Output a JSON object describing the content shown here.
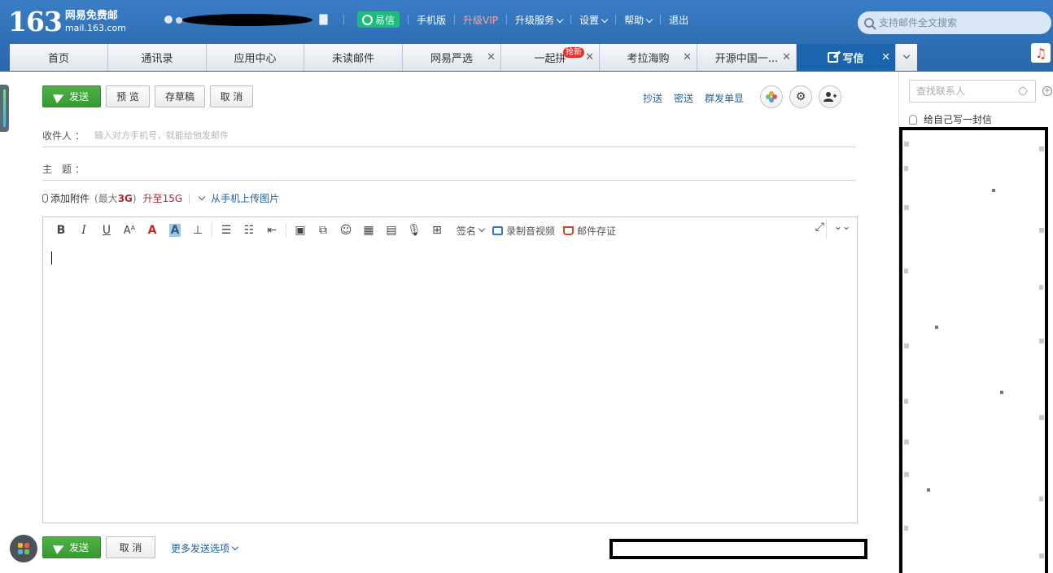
{
  "header": {
    "logo_number": "163",
    "logo_name": "网易免费邮",
    "logo_domain": "mail.163.com",
    "nav": {
      "yixin": "易信",
      "mobile": "手机版",
      "vip": "升级VIP",
      "upgrade_service": "升级服务",
      "settings": "设置",
      "help": "帮助",
      "logout": "退出"
    },
    "search_placeholder": "支持邮件全文搜索"
  },
  "tabs": [
    {
      "label": "首页"
    },
    {
      "label": "通讯录"
    },
    {
      "label": "应用中心"
    },
    {
      "label": "未读邮件"
    },
    {
      "label": "网易严选"
    },
    {
      "label": "一起拼",
      "badge": "抢新"
    },
    {
      "label": "考拉海购"
    },
    {
      "label": "开源中国一..."
    },
    {
      "label": "写信"
    }
  ],
  "compose": {
    "send": "发送",
    "preview": "预 览",
    "draft": "存草稿",
    "cancel": "取 消",
    "cc": "抄送",
    "bcc": "密送",
    "group_single": "群发单显",
    "recipient_label": "收件人 ：",
    "recipient_placeholder": "输入对方手机号，就能给他发邮件",
    "subject_label": "主　题 ：",
    "add_attachment": "添加附件",
    "max_prefix": "(最大",
    "max_size": "3G",
    "max_suffix": ")",
    "upgrade_size": "升至15G",
    "upload_from_phone": "从手机上传图片",
    "toolbar": {
      "signature": "签名",
      "record_video": "录制音视频",
      "evidence": "邮件存证"
    },
    "bottom_send": "发送",
    "bottom_cancel": "取 消",
    "more_options": "更多发送选项"
  },
  "sidebar": {
    "search_placeholder": "查找联系人",
    "write_to_self": "给自己写一封信"
  },
  "colors": {
    "header_blue": "#2f6fb6",
    "active_tab": "#1a65ad",
    "send_green": "#3fa538",
    "link_blue": "#1f5e9c",
    "accent_red": "#b3262d",
    "yixin_green": "#1ebc7a"
  }
}
